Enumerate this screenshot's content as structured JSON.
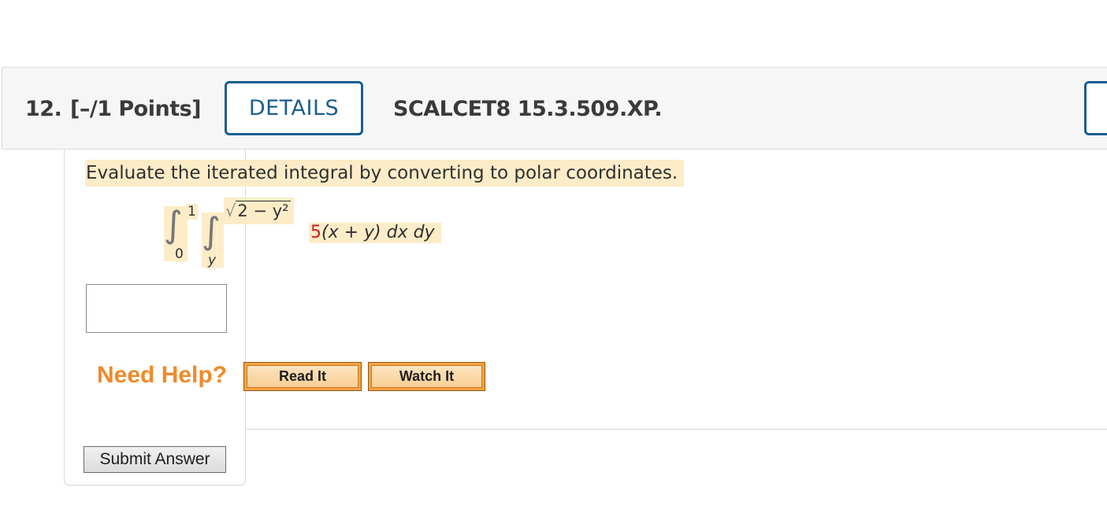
{
  "header": {
    "number": "12.",
    "points": "[–/1 Points]",
    "details_label": "DETAILS",
    "code": "SCALCET8 15.3.509.XP."
  },
  "question": {
    "text": "Evaluate the iterated integral by converting to polar coordinates.",
    "integral": {
      "outer_upper": "1",
      "outer_lower": "0",
      "inner_upper": "2 − y²",
      "inner_lower": "y",
      "coefficient": "5",
      "expression": "(x + y) dx dy"
    }
  },
  "help": {
    "label": "Need Help?",
    "read_it": "Read It",
    "watch_it": "Watch It"
  },
  "submit_label": "Submit Answer",
  "colors": {
    "accent_blue": "#1b5e8e",
    "highlight": "#fdecc8",
    "help_orange": "#f08a2a",
    "coefficient_red": "#d21f1f"
  }
}
